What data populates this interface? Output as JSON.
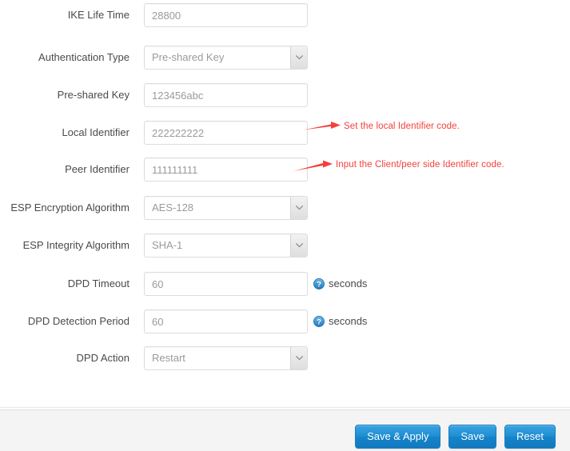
{
  "form": {
    "rows": [
      {
        "label": "IKE Life Time",
        "type": "text",
        "value": "28800",
        "unit": null,
        "help": false
      },
      {
        "label": "Authentication Type",
        "type": "select",
        "value": "Pre-shared Key",
        "unit": null,
        "help": false
      },
      {
        "label": "Pre-shared Key",
        "type": "text",
        "value": "123456abc",
        "unit": null,
        "help": false
      },
      {
        "label": "Local Identifier",
        "type": "text",
        "value": "222222222",
        "unit": null,
        "help": false
      },
      {
        "label": "Peer Identifier",
        "type": "text",
        "value": "111111111",
        "unit": null,
        "help": false
      },
      {
        "label": "ESP Encryption Algorithm",
        "type": "select",
        "value": "AES-128",
        "unit": null,
        "help": false
      },
      {
        "label": "ESP Integrity Algorithm",
        "type": "select",
        "value": "SHA-1",
        "unit": null,
        "help": false
      },
      {
        "label": "DPD Timeout",
        "type": "text",
        "value": "60",
        "unit": "seconds",
        "help": true
      },
      {
        "label": "DPD Detection Period",
        "type": "text",
        "value": "60",
        "unit": "seconds",
        "help": true
      },
      {
        "label": "DPD Action",
        "type": "select",
        "value": "Restart",
        "unit": null,
        "help": false
      }
    ]
  },
  "annotations": [
    {
      "text": "Set the local Identifier code.",
      "icon": "arrow-right-icon"
    },
    {
      "text": "Input the Client/peer side Identifier code.",
      "icon": "arrow-right-icon"
    }
  ],
  "footer": {
    "buttons": [
      {
        "label": "Save & Apply"
      },
      {
        "label": "Save"
      },
      {
        "label": "Reset"
      }
    ]
  },
  "colors": {
    "annotation_red": "#f4403c",
    "button_blue": "#1e8ed0",
    "help_icon_blue": "#2f8fd0",
    "footer_bg": "#f4f4f4",
    "input_border": "#dcdcdc",
    "label_text": "#4a4a4a",
    "value_text": "#9a9a9a"
  }
}
